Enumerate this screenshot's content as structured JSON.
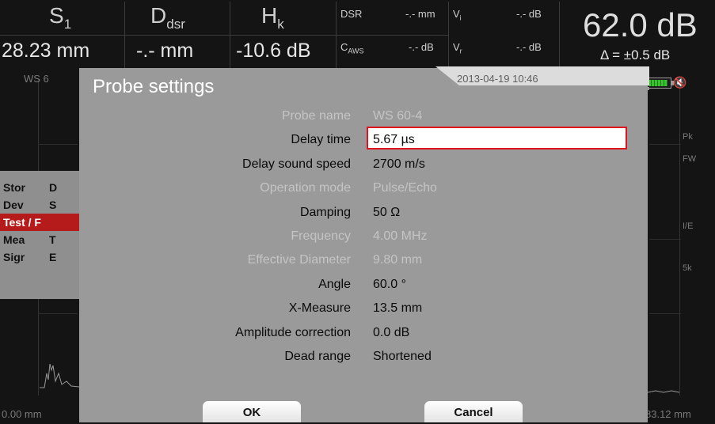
{
  "header": {
    "s1": {
      "symbol": "S",
      "sub": "1",
      "value": "28.23 mm"
    },
    "ddsr": {
      "symbol": "D",
      "sub": "dsr",
      "value": "-.- mm"
    },
    "hk": {
      "symbol": "H",
      "sub": "k",
      "value": "-10.6 dB"
    },
    "dsr": {
      "label": "DSR",
      "value": "-.- mm"
    },
    "caws": {
      "label": "C",
      "sub": "AWS",
      "value": "-.- dB"
    },
    "vi": {
      "label": "V",
      "sub": "i",
      "value": "-.- dB"
    },
    "vr": {
      "label": "V",
      "sub": "r",
      "value": "-.- dB"
    },
    "gain": "62.0 dB",
    "delta": "Δ = ±0.5 dB"
  },
  "background": {
    "probe_short": "WS 6",
    "range_start": "0.00 mm",
    "range_end": "83.12 mm",
    "right_labels": [
      "Pk",
      "FW",
      "I/E",
      "5k"
    ]
  },
  "menu": {
    "items": [
      {
        "a": "Stor",
        "b": "D",
        "selected": false
      },
      {
        "a": "Dev",
        "b": "S",
        "selected": false
      },
      {
        "a": "Test / F",
        "b": "",
        "selected": true
      },
      {
        "a": "Mea",
        "b": "T",
        "selected": false
      },
      {
        "a": "Sigr",
        "b": "E",
        "selected": false
      }
    ]
  },
  "status": {
    "datetime": "2013-04-19 10:46",
    "battery_level": 0.9
  },
  "dialog": {
    "title": "Probe settings",
    "rows": [
      {
        "label": "Probe name",
        "value": "WS 60-4",
        "enabled": false
      },
      {
        "label": "Delay time",
        "value": "5.67 µs",
        "enabled": true,
        "editing": true
      },
      {
        "label": "Delay sound speed",
        "value": "2700 m/s",
        "enabled": true
      },
      {
        "label": "Operation mode",
        "value": "Pulse/Echo",
        "enabled": false
      },
      {
        "label": "Damping",
        "value": "50 Ω",
        "enabled": true
      },
      {
        "label": "Frequency",
        "value": "4.00 MHz",
        "enabled": false
      },
      {
        "label": "Effective Diameter",
        "value": "9.80 mm",
        "enabled": false
      },
      {
        "label": "Angle",
        "value": "60.0 °",
        "enabled": true
      },
      {
        "label": "X-Measure",
        "value": "13.5 mm",
        "enabled": true
      },
      {
        "label": "Amplitude correction",
        "value": "0.0 dB",
        "enabled": true
      },
      {
        "label": "Dead range",
        "value": "Shortened",
        "enabled": true
      }
    ],
    "ok_label": "OK",
    "cancel_label": "Cancel"
  },
  "colors": {
    "accent": "#b51b1b",
    "highlight_border": "#e0141e",
    "dialog_bg": "#9a9a9a"
  }
}
